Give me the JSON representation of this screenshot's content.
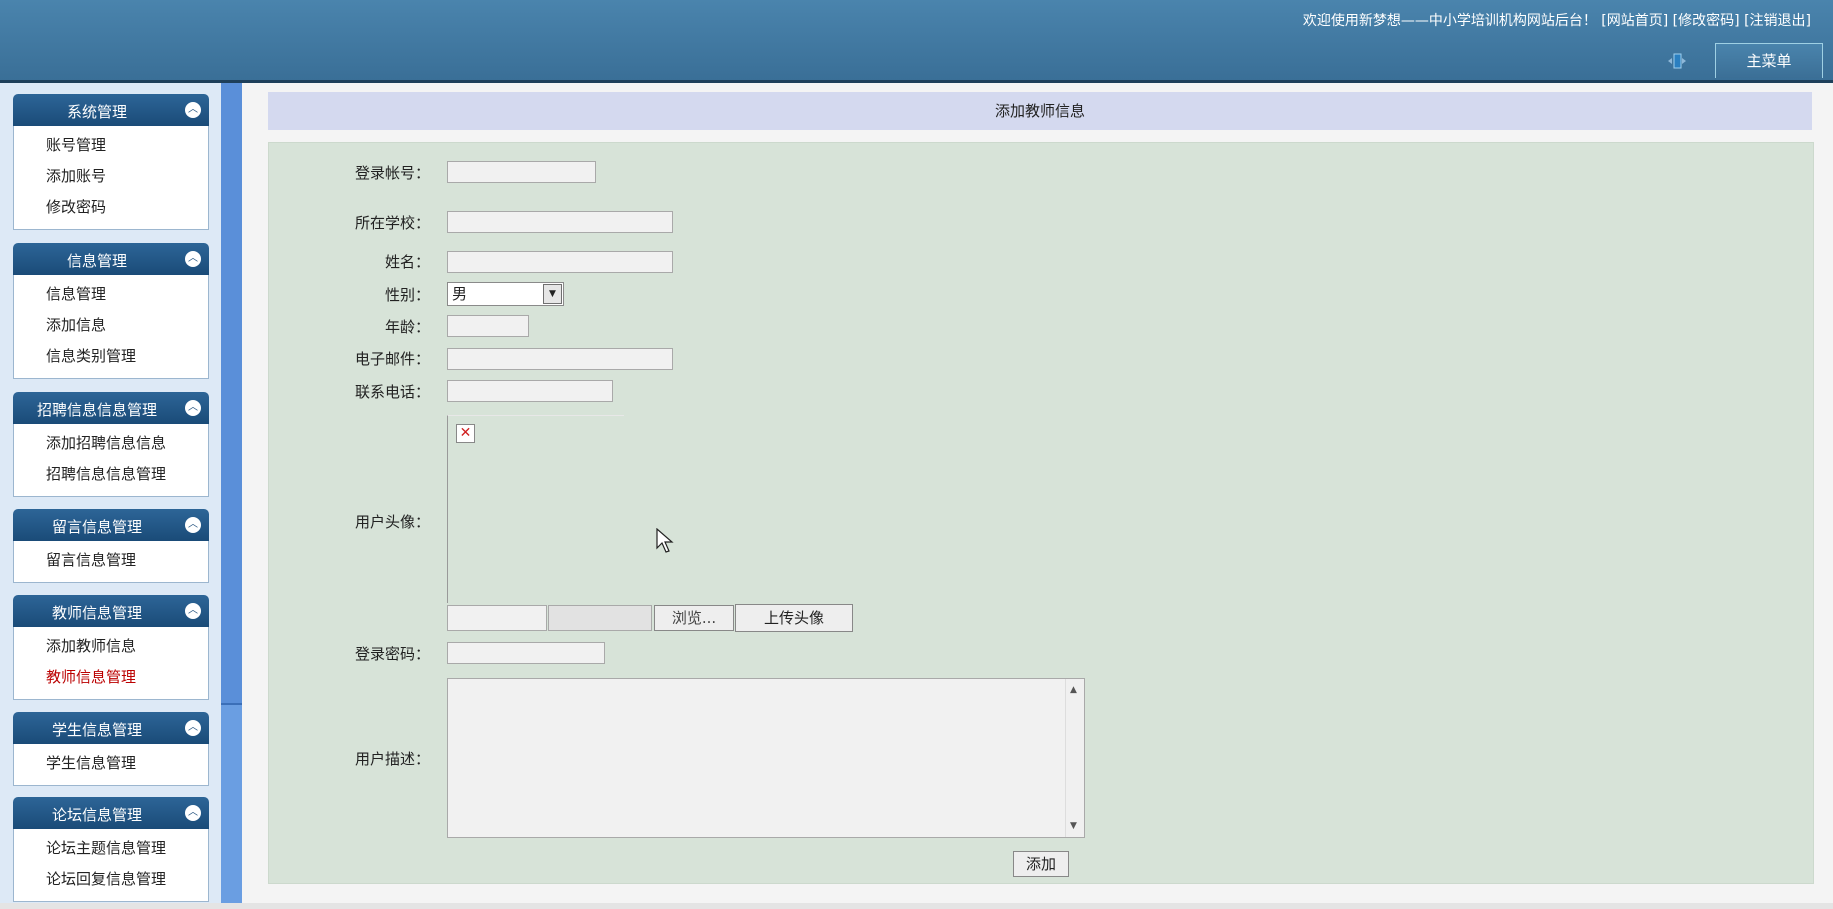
{
  "header": {
    "welcome": "欢迎使用新梦想——中小学培训机构网站后台！",
    "links": [
      "[网站首页]",
      "[修改密码]",
      "[注销退出]"
    ],
    "main_menu": "主菜单"
  },
  "sidebar": {
    "groups": [
      {
        "title": "系统管理",
        "items": [
          "账号管理",
          "添加账号",
          "修改密码"
        ]
      },
      {
        "title": "信息管理",
        "items": [
          "信息管理",
          "添加信息",
          "信息类别管理"
        ]
      },
      {
        "title": "招聘信息信息管理",
        "items": [
          "添加招聘信息信息",
          "招聘信息信息管理"
        ]
      },
      {
        "title": "留言信息管理",
        "items": [
          "留言信息管理"
        ]
      },
      {
        "title": "教师信息管理",
        "items": [
          "添加教师信息",
          "教师信息管理"
        ]
      },
      {
        "title": "学生信息管理",
        "items": [
          "学生信息管理"
        ]
      },
      {
        "title": "论坛信息管理",
        "items": [
          "论坛主题信息管理",
          "论坛回复信息管理"
        ]
      }
    ],
    "active_item": "教师信息管理"
  },
  "form": {
    "title": "添加教师信息",
    "labels": {
      "account": "登录帐号：",
      "school": "所在学校：",
      "name": "姓名：",
      "gender": "性别：",
      "age": "年龄：",
      "email": "电子邮件：",
      "phone": "联系电话：",
      "avatar": "用户头像：",
      "password": "登录密码：",
      "description": "用户描述："
    },
    "gender_value": "男",
    "browse_label": "浏览...",
    "upload_label": "上传头像",
    "submit_label": "添加"
  },
  "colors": {
    "header": "#3d739b",
    "sidebar_head": "#245a8a",
    "panel_title": "#d4d9ef",
    "panel_body": "#d7e3d8",
    "active": "#bb0000"
  }
}
